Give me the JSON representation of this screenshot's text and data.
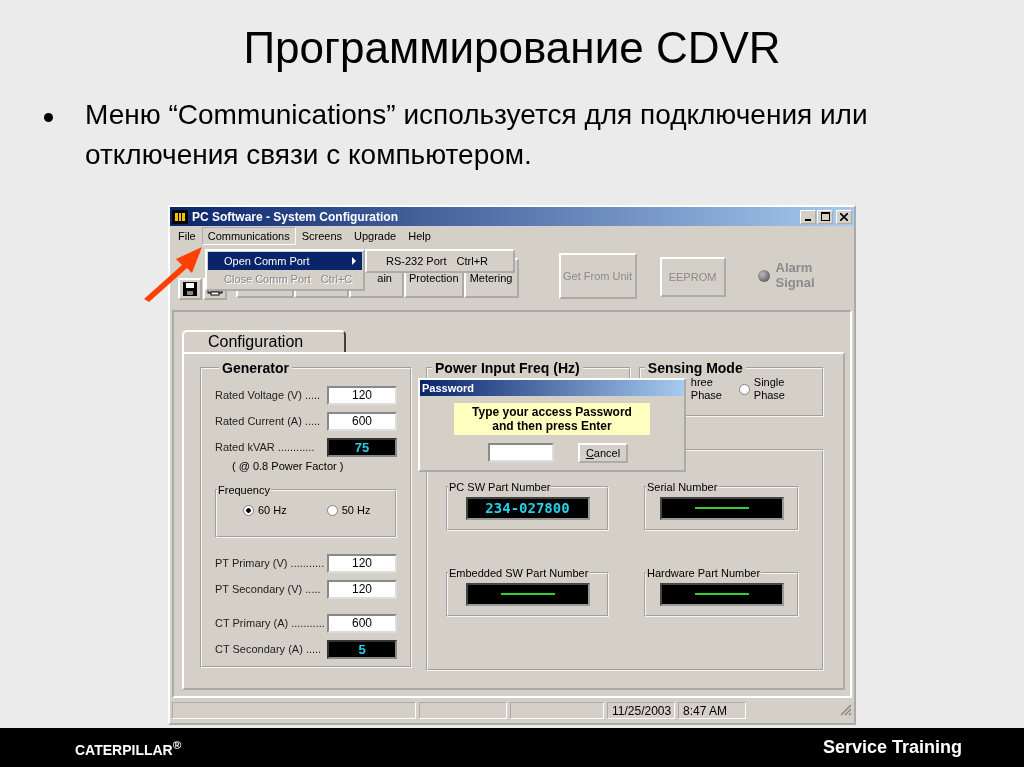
{
  "slide_title": "Программирование CDVR",
  "bullets": [
    "Меню “Communications” используется для подключения или отключения связи с компьютером."
  ],
  "window": {
    "title": "PC Software - System Configuration"
  },
  "menu_bar": [
    {
      "label": "File",
      "selected": false
    },
    {
      "label": "Communications",
      "selected": true
    },
    {
      "label": "Screens",
      "selected": false
    },
    {
      "label": "Upgrade",
      "selected": false
    },
    {
      "label": "Help",
      "selected": false
    }
  ],
  "communications_menu": [
    {
      "label": "Open Comm Port",
      "disabled": false,
      "selected": true,
      "has_submenu": true
    },
    {
      "label": "Close Comm Port",
      "shortcut": "Ctrl+C",
      "disabled": true,
      "selected": false,
      "has_submenu": false
    }
  ],
  "submenu": [
    {
      "label": "RS-232 Port",
      "shortcut": "Ctrl+R"
    }
  ],
  "toolbar_buttons": [
    {
      "label": "ain"
    },
    {
      "label": "Protection"
    },
    {
      "label": "Metering"
    }
  ],
  "action_buttons": [
    {
      "label": "Get From Unit",
      "disabled": true
    },
    {
      "label": "EEPROM",
      "disabled": true
    }
  ],
  "alarm": {
    "label": "Alarm Signal",
    "on": false
  },
  "tab": {
    "label": "Configuration",
    "selected": true
  },
  "generator": {
    "title": "Generator",
    "fields": [
      {
        "label": "Rated Voltage (V) .....",
        "value": "120",
        "kind": "input"
      },
      {
        "label": "Rated Current (A) .....",
        "value": "600",
        "kind": "input"
      },
      {
        "label": "Rated kVAR ............",
        "value": "75",
        "kind": "display"
      }
    ],
    "note": "( @ 0.8 Power Factor )",
    "frequency": {
      "title": "Frequency",
      "options": [
        {
          "label": "60 Hz",
          "selected": true
        },
        {
          "label": "50 Hz",
          "selected": false
        }
      ]
    },
    "pt_fields": [
      {
        "label": "PT Primary (V) ...........",
        "value": "120",
        "kind": "input"
      },
      {
        "label": "PT Secondary (V) .....",
        "value": "120",
        "kind": "input"
      }
    ],
    "ct_fields": [
      {
        "label": "CT Primary (A) ...........",
        "value": "600",
        "kind": "input"
      },
      {
        "label": "CT Secondary (A) .....",
        "value": "5",
        "kind": "display"
      }
    ]
  },
  "power_input_freq": {
    "title": "Power Input Freq (Hz)"
  },
  "sensing_mode": {
    "title": "Sensing Mode",
    "partial_option": "hree Phase",
    "options": [
      {
        "label": "Single Phase",
        "selected": false
      }
    ]
  },
  "part_numbers": [
    {
      "title": "PC SW Part Number",
      "value": "234-027800"
    },
    {
      "title": "Serial Number"
    },
    {
      "title": "Embedded SW Part Number"
    },
    {
      "title": "Hardware Part Number"
    }
  ],
  "dialog": {
    "title": "Password",
    "message": "Type your access Password and then press Enter",
    "cancel": "Cancel"
  },
  "status_bar": {
    "date": "11/25/2003",
    "time": "8:47 AM"
  },
  "footer": {
    "logo": "CATERPILLAR$^{®}$",
    "right": "Service Training"
  }
}
